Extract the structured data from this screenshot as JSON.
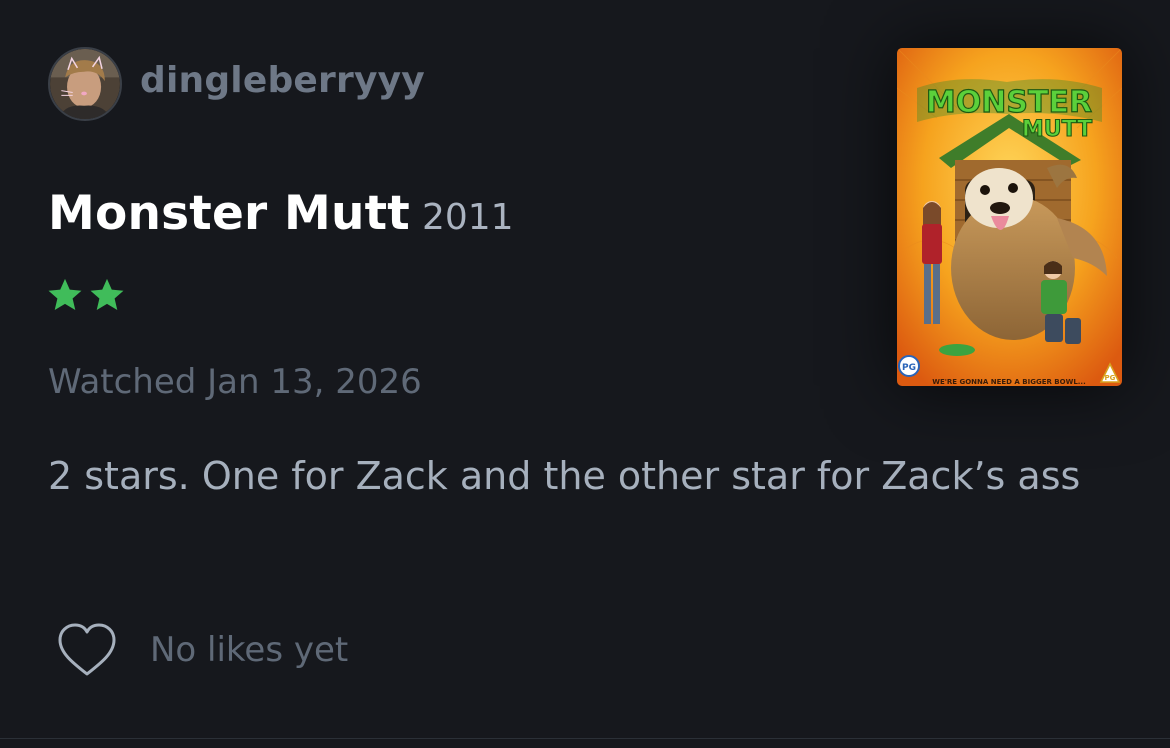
{
  "review": {
    "author": {
      "username": "dingleberryyy",
      "avatar_icon": "avatar"
    },
    "film": {
      "title": "Monster Mutt",
      "year": "2011",
      "poster": {
        "title_line1": "MONSTER",
        "title_line2": "MUTT",
        "tagline": "WE'RE GONNA NEED A BIGGER BOWL...",
        "rating_badge": "PG"
      }
    },
    "rating": {
      "stars": 2,
      "star_icon": "star-icon",
      "star_color": "#40bc5a"
    },
    "watched": "Watched Jan 13, 2026",
    "text": "2 stars. One for Zack and the other star for Zack’s ass",
    "likes": {
      "label": "No likes yet",
      "icon": "heart-icon"
    }
  },
  "colors": {
    "background": "#16181d",
    "username": "#6e7887",
    "title": "#ffffff",
    "year": "#aab3c0",
    "meta": "#5f6977",
    "body_text": "#a6b0bd"
  }
}
